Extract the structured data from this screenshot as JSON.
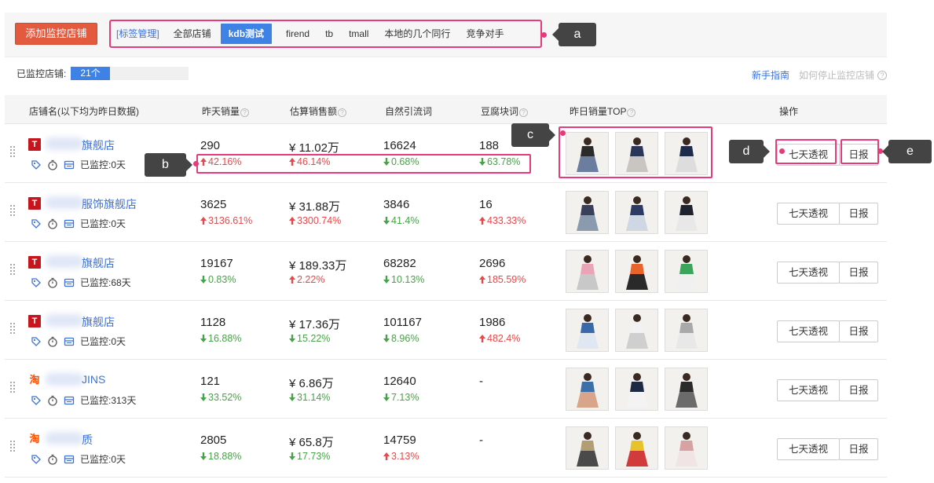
{
  "toolbar": {
    "add_label": "添加监控店铺",
    "tags": [
      {
        "label": "[标签管理]",
        "kind": "manage"
      },
      {
        "label": "全部店铺",
        "kind": "normal"
      },
      {
        "label": "kdb测试",
        "kind": "active"
      },
      {
        "label": "firend",
        "kind": "normal"
      },
      {
        "label": "tb",
        "kind": "normal"
      },
      {
        "label": "tmall",
        "kind": "normal"
      },
      {
        "label": "本地的几个同行",
        "kind": "normal"
      },
      {
        "label": "竞争对手",
        "kind": "normal"
      }
    ]
  },
  "callouts": {
    "a": "a",
    "b": "b",
    "c": "c",
    "d": "d",
    "e": "e"
  },
  "monitored": {
    "label": "已监控店铺:",
    "count": "21个",
    "fill_fraction": 0.33
  },
  "links": {
    "guide": "新手指南",
    "stop": "如何停止监控店铺"
  },
  "table": {
    "headers": {
      "shop": "店铺名(以下均为昨日数据)",
      "sales": "昨天销量",
      "revenue": "估算销售额",
      "traffic": "自然引流词",
      "tofu": "豆腐块词",
      "top": "昨日销量TOP",
      "ops": "操作"
    },
    "seven_label": "七天透视",
    "daily_label": "日报",
    "rows": [
      {
        "platform": "tmall",
        "platform_glyph": "T",
        "name": "旗舰店",
        "monitor": "已监控:0天",
        "sales": "290",
        "sales_chg": "42.16%",
        "sales_dir": "up",
        "revenue": "¥ 11.02万",
        "revenue_chg": "46.14%",
        "revenue_dir": "up",
        "traffic": "16624",
        "traffic_chg": "0.68%",
        "traffic_dir": "down",
        "tofu": "188",
        "tofu_chg": "63.78%",
        "tofu_dir": "down"
      },
      {
        "platform": "tmall",
        "platform_glyph": "T",
        "name": "服饰旗舰店",
        "monitor": "已监控:0天",
        "sales": "3625",
        "sales_chg": "3136.61%",
        "sales_dir": "up",
        "revenue": "¥ 31.88万",
        "revenue_chg": "3300.74%",
        "revenue_dir": "up",
        "traffic": "3846",
        "traffic_chg": "41.4%",
        "traffic_dir": "down",
        "tofu": "16",
        "tofu_chg": "433.33%",
        "tofu_dir": "up"
      },
      {
        "platform": "tmall",
        "platform_glyph": "T",
        "name": "旗舰店",
        "monitor": "已监控:68天",
        "sales": "19167",
        "sales_chg": "0.83%",
        "sales_dir": "down",
        "revenue": "¥ 189.33万",
        "revenue_chg": "2.22%",
        "revenue_dir": "up",
        "traffic": "68282",
        "traffic_chg": "10.13%",
        "traffic_dir": "down",
        "tofu": "2696",
        "tofu_chg": "185.59%",
        "tofu_dir": "up"
      },
      {
        "platform": "tmall",
        "platform_glyph": "T",
        "name": "旗舰店",
        "monitor": "已监控:0天",
        "sales": "1128",
        "sales_chg": "16.88%",
        "sales_dir": "down",
        "revenue": "¥ 17.36万",
        "revenue_chg": "15.22%",
        "revenue_dir": "down",
        "traffic": "101167",
        "traffic_chg": "8.96%",
        "traffic_dir": "down",
        "tofu": "1986",
        "tofu_chg": "482.4%",
        "tofu_dir": "up"
      },
      {
        "platform": "taobao",
        "platform_glyph": "淘",
        "name": "JINS",
        "monitor": "已监控:313天",
        "sales": "121",
        "sales_chg": "33.52%",
        "sales_dir": "down",
        "revenue": "¥ 6.86万",
        "revenue_chg": "31.14%",
        "revenue_dir": "down",
        "traffic": "12640",
        "traffic_chg": "7.13%",
        "traffic_dir": "down",
        "tofu": "-",
        "tofu_chg": "",
        "tofu_dir": "none"
      },
      {
        "platform": "taobao",
        "platform_glyph": "淘",
        "name": "质",
        "monitor": "已监控:0天",
        "sales": "2805",
        "sales_chg": "18.88%",
        "sales_dir": "down",
        "revenue": "¥ 65.8万",
        "revenue_chg": "17.73%",
        "revenue_dir": "down",
        "traffic": "14759",
        "traffic_chg": "3.13%",
        "traffic_dir": "up",
        "tofu": "-",
        "tofu_chg": "",
        "tofu_dir": "none"
      }
    ]
  },
  "colors": {
    "accent": "#3f82e6",
    "add_button": "#e45a3f",
    "highlight": "#e63a7b",
    "up": "#e8484a",
    "down": "#47a347",
    "tmall": "#c6151c",
    "taobao": "#ff5000"
  }
}
